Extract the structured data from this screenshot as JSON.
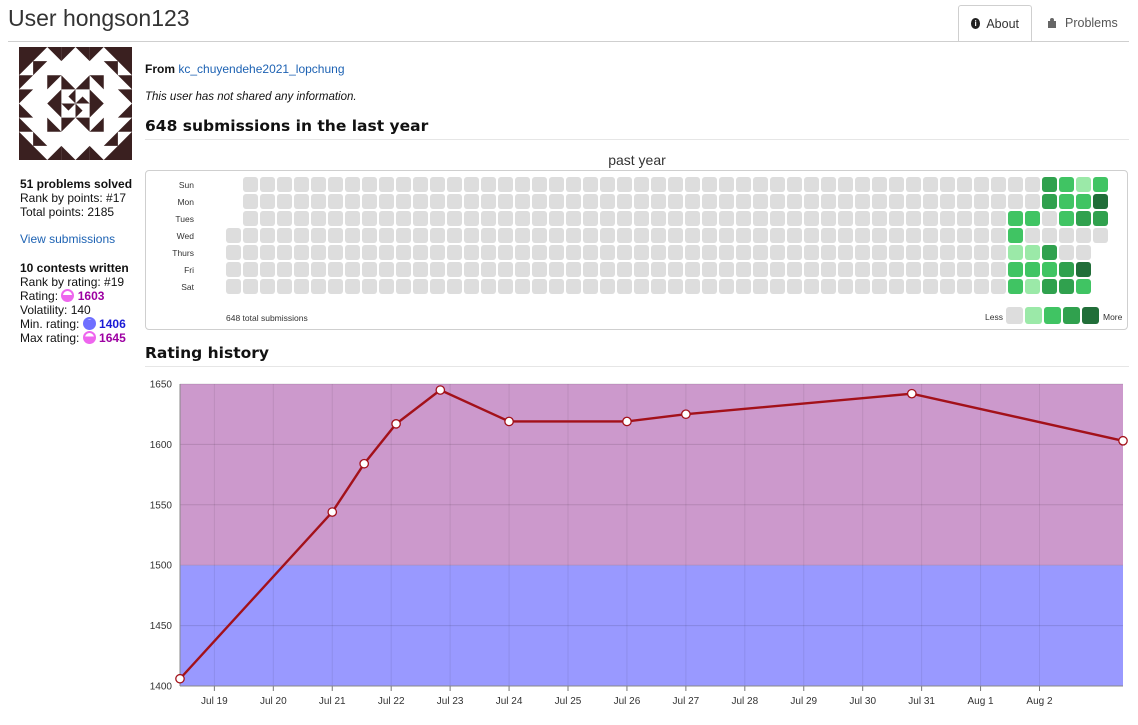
{
  "header": {
    "title": "User hongson123",
    "tabs": [
      {
        "label": "About",
        "icon": "info-icon",
        "active": true
      },
      {
        "label": "Problems",
        "icon": "puzzle-icon",
        "active": false
      }
    ]
  },
  "sidebar": {
    "problems_solved": "51 problems solved",
    "rank_by_points": "Rank by points: #17",
    "total_points": "Total points: 2185",
    "view_submissions": "View submissions",
    "contests_written": "10 contests written",
    "rank_by_rating": "Rank by rating: #19",
    "rating_label": "Rating:",
    "rating_value": "1603",
    "volatility": "Volatility: 140",
    "min_rating_label": "Min. rating:",
    "min_rating_value": "1406",
    "max_rating_label": "Max rating:",
    "max_rating_value": "1645",
    "colors": {
      "rating": "#9d00a2",
      "min_rating": "#1a1ad6",
      "max_rating": "#9d00a2"
    }
  },
  "about": {
    "from_label": "From",
    "from_org": "kc_chuyendehe2021_lopchung",
    "info_text": "This user has not shared any information."
  },
  "submissions": {
    "heading": "648 submissions in the last year",
    "caption": "past year",
    "day_labels": [
      "Sun",
      "Mon",
      "Tues",
      "Wed",
      "Thurs",
      "Fri",
      "Sat"
    ],
    "total_text": "648 total submissions",
    "legend_less": "Less",
    "legend_more": "More",
    "level_colors": [
      "#dddddd",
      "#9be9a8",
      "#40c463",
      "#30a14e",
      "#216e39"
    ],
    "recent_weeks": [
      [
        0,
        0,
        0,
        0,
        0,
        0,
        0
      ],
      [
        0,
        0,
        0,
        0,
        0,
        0,
        0
      ],
      [
        0,
        0,
        2,
        2,
        1,
        2,
        2
      ],
      [
        0,
        0,
        2,
        0,
        1,
        2,
        1
      ],
      [
        3,
        3,
        0,
        0,
        3,
        2,
        3
      ],
      [
        2,
        2,
        2,
        0,
        0,
        3,
        3
      ],
      [
        1,
        2,
        3,
        0,
        0,
        4,
        2
      ],
      [
        2,
        4,
        3,
        0,
        null,
        null,
        null
      ]
    ]
  },
  "rating_history": {
    "heading": "Rating history",
    "colors": {
      "line": "#a3111a",
      "band_purple": "#cc99cc",
      "band_blue": "#9999ff"
    }
  },
  "chart_data": {
    "type": "line",
    "x": [
      "2021-07-18",
      "2021-07-21",
      "2021-07-21",
      "2021-07-22",
      "2021-07-22",
      "2021-07-24",
      "2021-07-26",
      "2021-07-27",
      "2021-07-30",
      "2021-08-03"
    ],
    "values": [
      1406,
      1544,
      1584,
      1617,
      1645,
      1619,
      1619,
      1625,
      1642,
      1603
    ],
    "x_tick_labels": [
      "Jul 19",
      "Jul 20",
      "Jul 21",
      "Jul 22",
      "Jul 23",
      "Jul 24",
      "Jul 25",
      "Jul 26",
      "Jul 27",
      "Jul 28",
      "Jul 29",
      "Jul 30",
      "Jul 31",
      "Aug 1",
      "Aug 2"
    ],
    "y_ticks": [
      1400,
      1450,
      1500,
      1550,
      1600,
      1650
    ],
    "ylim": [
      1400,
      1650
    ],
    "bands": [
      {
        "from": 1400,
        "to": 1500,
        "color": "#9999ff"
      },
      {
        "from": 1500,
        "to": 1650,
        "color": "#cc99cc"
      }
    ],
    "grid": true
  }
}
